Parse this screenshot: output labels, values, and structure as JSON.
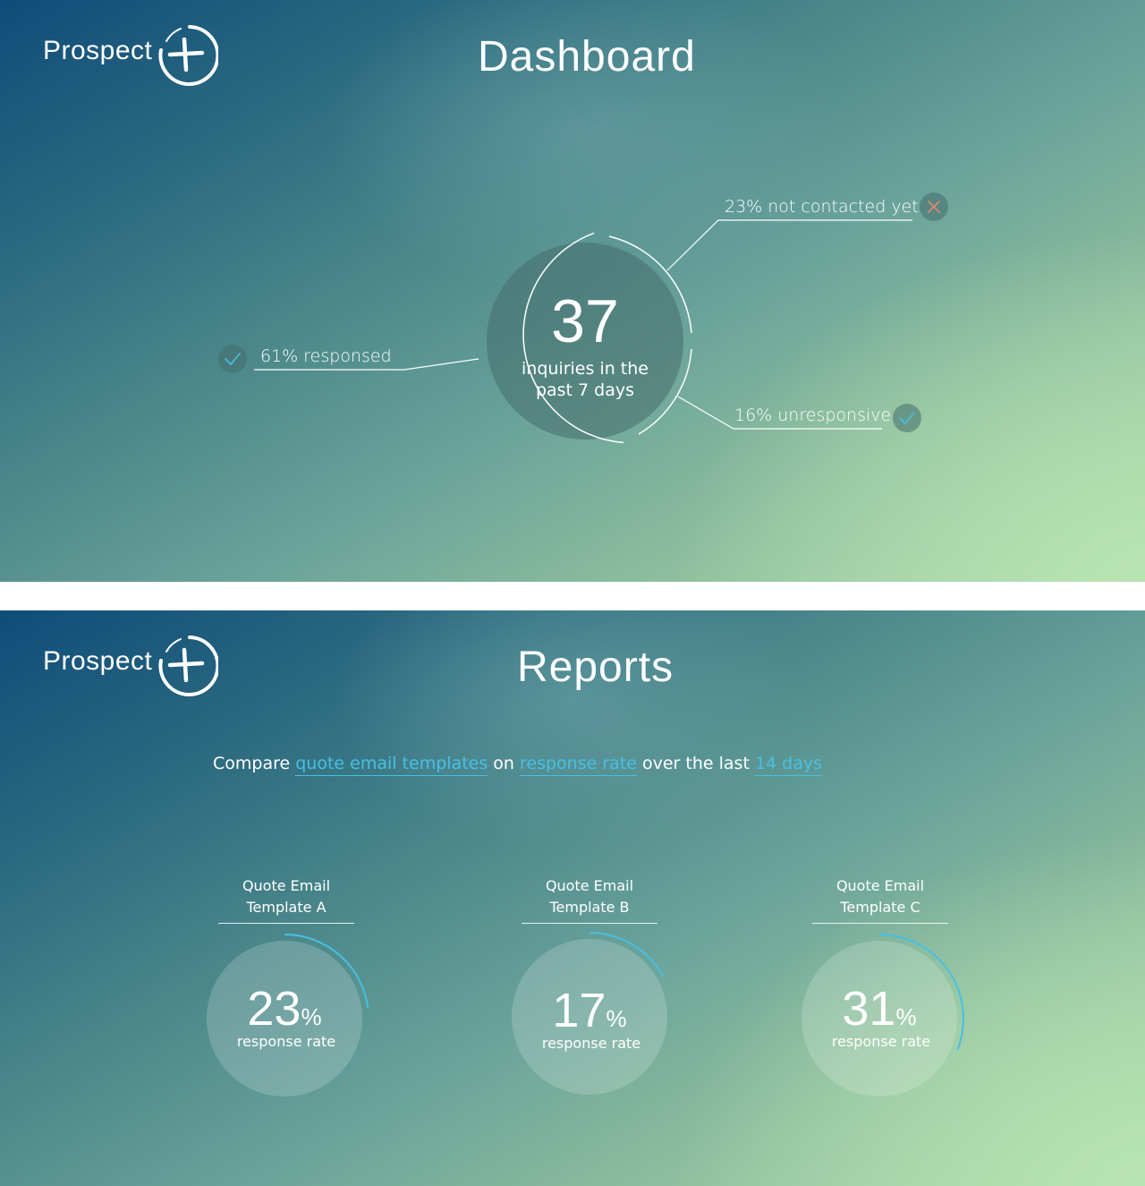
{
  "brand": {
    "name": "Prospect",
    "logo_icon": "plus-circle-icon"
  },
  "dashboard": {
    "title": "Dashboard",
    "total": "37",
    "total_caption_line1": "inquiries in the",
    "total_caption_line2": "past 7 days",
    "segments": {
      "not_contacted": {
        "label": "23% not contacted yet",
        "icon": "close-icon",
        "status_color": "#e3876e"
      },
      "responsed": {
        "label": "61% responsed",
        "icon": "check-icon",
        "status_color": "#47c0e4"
      },
      "unresponsive": {
        "label": "16% unresponsive",
        "icon": "check-icon",
        "status_color": "#47c0e4"
      }
    }
  },
  "reports": {
    "title": "Reports",
    "compare": {
      "prefix": "Compare",
      "subject": "quote email templates",
      "on": "on",
      "metric": "response rate",
      "over": "over the last",
      "period": "14 days"
    },
    "accent_color": "#47c0e4",
    "templates": [
      {
        "head_line1": "Quote Email",
        "head_line2": "Template A",
        "value": "23",
        "unit": "%",
        "caption": "response rate"
      },
      {
        "head_line1": "Quote Email",
        "head_line2": "Template B",
        "value": "17",
        "unit": "%",
        "caption": "response rate"
      },
      {
        "head_line1": "Quote Email",
        "head_line2": "Template C",
        "value": "31",
        "unit": "%",
        "caption": "response rate"
      }
    ]
  }
}
